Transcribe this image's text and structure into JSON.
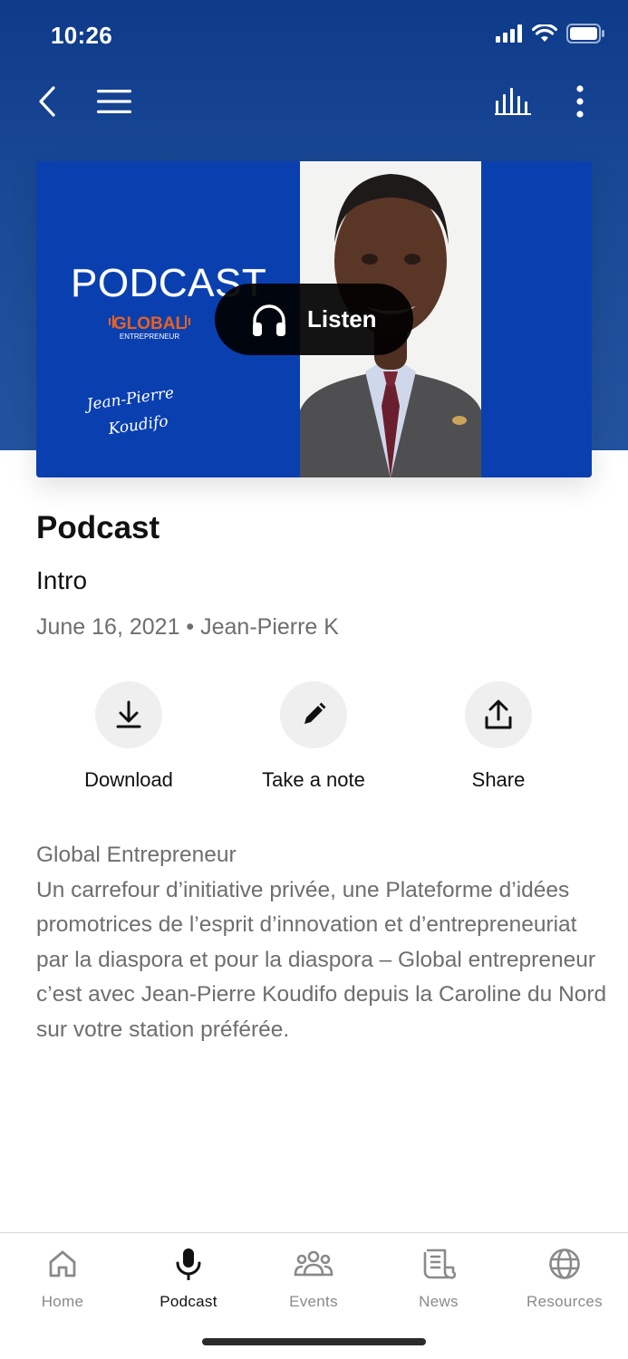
{
  "status_bar": {
    "time": "10:26"
  },
  "hero": {
    "cover_title": "PODCAST",
    "logo_text": "GLOBAL",
    "logo_subtext": "ENTREPRENEUR",
    "signature_line1": "Jean-Pierre",
    "signature_line2": "Koudifo",
    "listen_label": "Listen"
  },
  "episode": {
    "section_title": "Podcast",
    "title": "Intro",
    "meta": "June 16, 2021 • Jean-Pierre K"
  },
  "actions": [
    {
      "label": "Download",
      "icon": "download-icon"
    },
    {
      "label": "Take a note",
      "icon": "pencil-icon"
    },
    {
      "label": "Share",
      "icon": "share-icon"
    }
  ],
  "description": {
    "heading": "Global Entrepreneur",
    "body": "Un carrefour d’initiative privée, une Plateforme d’idées promotrices de l’esprit d’innovation et d’entrepreneuriat par la diaspora et pour la diaspora – Global entrepreneur c’est avec Jean-Pierre Koudifo depuis la Caroline du Nord sur votre station préférée."
  },
  "tabs": [
    {
      "label": "Home",
      "icon": "home-icon",
      "active": false
    },
    {
      "label": "Podcast",
      "icon": "microphone-icon",
      "active": true
    },
    {
      "label": "Events",
      "icon": "people-icon",
      "active": false
    },
    {
      "label": "News",
      "icon": "newspaper-icon",
      "active": false
    },
    {
      "label": "Resources",
      "icon": "globe-icon",
      "active": false
    }
  ],
  "colors": {
    "hero_blue": "#0e3a8a",
    "cover_blue": "#0a3fb0",
    "logo_orange": "#e8621e",
    "text_primary": "#111111",
    "text_secondary": "#6e6e6e"
  }
}
